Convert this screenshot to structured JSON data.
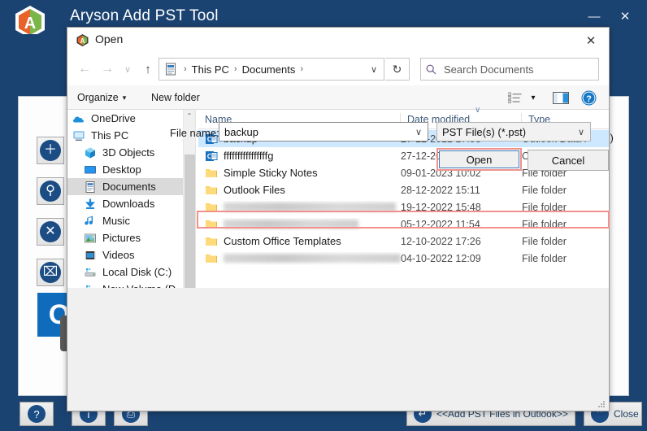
{
  "app": {
    "title": "Aryson Add PST Tool",
    "window_buttons": {
      "minimize": "—",
      "close": "✕"
    },
    "logo_icon": "aryson-logo-icon",
    "right_label": "s)",
    "tool_buttons": [
      {
        "name": "add-button",
        "glyph": "＋"
      },
      {
        "name": "search-button",
        "glyph": "⚲"
      },
      {
        "name": "remove-button",
        "glyph": "✕"
      },
      {
        "name": "remove-all-button",
        "glyph": "⌧"
      }
    ],
    "footer": {
      "help_glyph": "?",
      "info_glyph": "i",
      "print_glyph": "⎙",
      "add_pst_label": "<<Add PST Files in Outlook>>",
      "add_pst_glyph": "↵",
      "close_label": "Close",
      "close_glyph": "⌃"
    }
  },
  "dialog": {
    "title": "Open",
    "icon": "aryson-app-icon",
    "close_glyph": "✕",
    "nav": {
      "back_glyph": "←",
      "forward_glyph": "→",
      "recent_glyph": "∨",
      "up_glyph": "↑",
      "refresh_glyph": "↻",
      "breadcrumb_icon": "documents-folder-icon",
      "breadcrumb": [
        "This PC",
        "Documents"
      ],
      "breadcrumb_separator": "›",
      "breadcrumb_dropdown_glyph": "∨"
    },
    "search": {
      "icon": "search-icon",
      "placeholder": "Search Documents",
      "value": ""
    },
    "commandbar": {
      "organize_label": "Organize",
      "organize_caret": "▾",
      "new_folder_label": "New folder",
      "view_icon": "list-view-icon",
      "view_caret": "▾",
      "preview_pane_icon": "preview-pane-icon",
      "help_icon": "help-icon",
      "help_glyph": "?"
    },
    "navpane": {
      "items": [
        {
          "label": "OneDrive",
          "icon": "onedrive-icon",
          "indent": false,
          "selected": false
        },
        {
          "label": "This PC",
          "icon": "thispc-icon",
          "indent": false,
          "selected": false
        },
        {
          "label": "3D Objects",
          "icon": "3dobjects-icon",
          "indent": true,
          "selected": false
        },
        {
          "label": "Desktop",
          "icon": "desktop-icon",
          "indent": true,
          "selected": false
        },
        {
          "label": "Documents",
          "icon": "documents-icon",
          "indent": true,
          "selected": true
        },
        {
          "label": "Downloads",
          "icon": "downloads-icon",
          "indent": true,
          "selected": false
        },
        {
          "label": "Music",
          "icon": "music-icon",
          "indent": true,
          "selected": false
        },
        {
          "label": "Pictures",
          "icon": "pictures-icon",
          "indent": true,
          "selected": false
        },
        {
          "label": "Videos",
          "icon": "videos-icon",
          "indent": true,
          "selected": false
        },
        {
          "label": "Local Disk (C:)",
          "icon": "drive-icon",
          "indent": true,
          "selected": false
        },
        {
          "label": "New Volume (D",
          "icon": "drive-icon",
          "indent": true,
          "selected": false
        }
      ]
    },
    "filelist": {
      "columns": [
        "Name",
        "Date modified",
        "Type"
      ],
      "sort_indicator": "∨",
      "sorted_column": "Date modified",
      "rows": [
        {
          "name": "backup",
          "date": "27-12-2022 17:53",
          "type": "Outlook Data F",
          "icon": "outlook-pst-icon",
          "selected": true,
          "redacted": false
        },
        {
          "name": "ffffffffffffffffg",
          "date": "27-12-2022 17:53",
          "type": "Outlook Data F",
          "icon": "outlook-pst-icon",
          "selected": false,
          "redacted": false
        },
        {
          "name": "Simple Sticky Notes",
          "date": "09-01-2023 10:02",
          "type": "File folder",
          "icon": "folder-icon",
          "selected": false,
          "redacted": false
        },
        {
          "name": "Outlook Files",
          "date": "28-12-2022 15:11",
          "type": "File folder",
          "icon": "folder-icon",
          "selected": false,
          "redacted": false
        },
        {
          "name": "",
          "date": "19-12-2022 15:48",
          "type": "File folder",
          "icon": "folder-icon",
          "selected": false,
          "redacted": true,
          "redacted_width": 212
        },
        {
          "name": "",
          "date": "05-12-2022 11:54",
          "type": "File folder",
          "icon": "folder-icon",
          "selected": false,
          "redacted": true,
          "redacted_width": 166
        },
        {
          "name": "Custom Office Templates",
          "date": "12-10-2022 17:26",
          "type": "File folder",
          "icon": "folder-icon",
          "selected": false,
          "redacted": false
        },
        {
          "name": "",
          "date": "04-10-2022 12:09",
          "type": "File folder",
          "icon": "folder-icon",
          "selected": false,
          "redacted": true,
          "redacted_width": 218
        }
      ]
    },
    "bottom": {
      "filename_label": "File name:",
      "filename_value": "backup",
      "filename_dropdown_glyph": "∨",
      "filter_value": "PST File(s) (*.pst)",
      "filter_dropdown_glyph": "∨",
      "open_label": "Open",
      "cancel_label": "Cancel"
    },
    "scrollbars": {
      "nav_up_glyph": "⌃",
      "nav_down_glyph": "⌄",
      "h_left_glyph": "‹",
      "h_right_glyph": "›"
    }
  },
  "colors": {
    "app_blue": "#1b4371",
    "selection_blue": "#cde8ff",
    "highlight_red": "#f1918d",
    "accent_blue": "#1b4c84"
  }
}
